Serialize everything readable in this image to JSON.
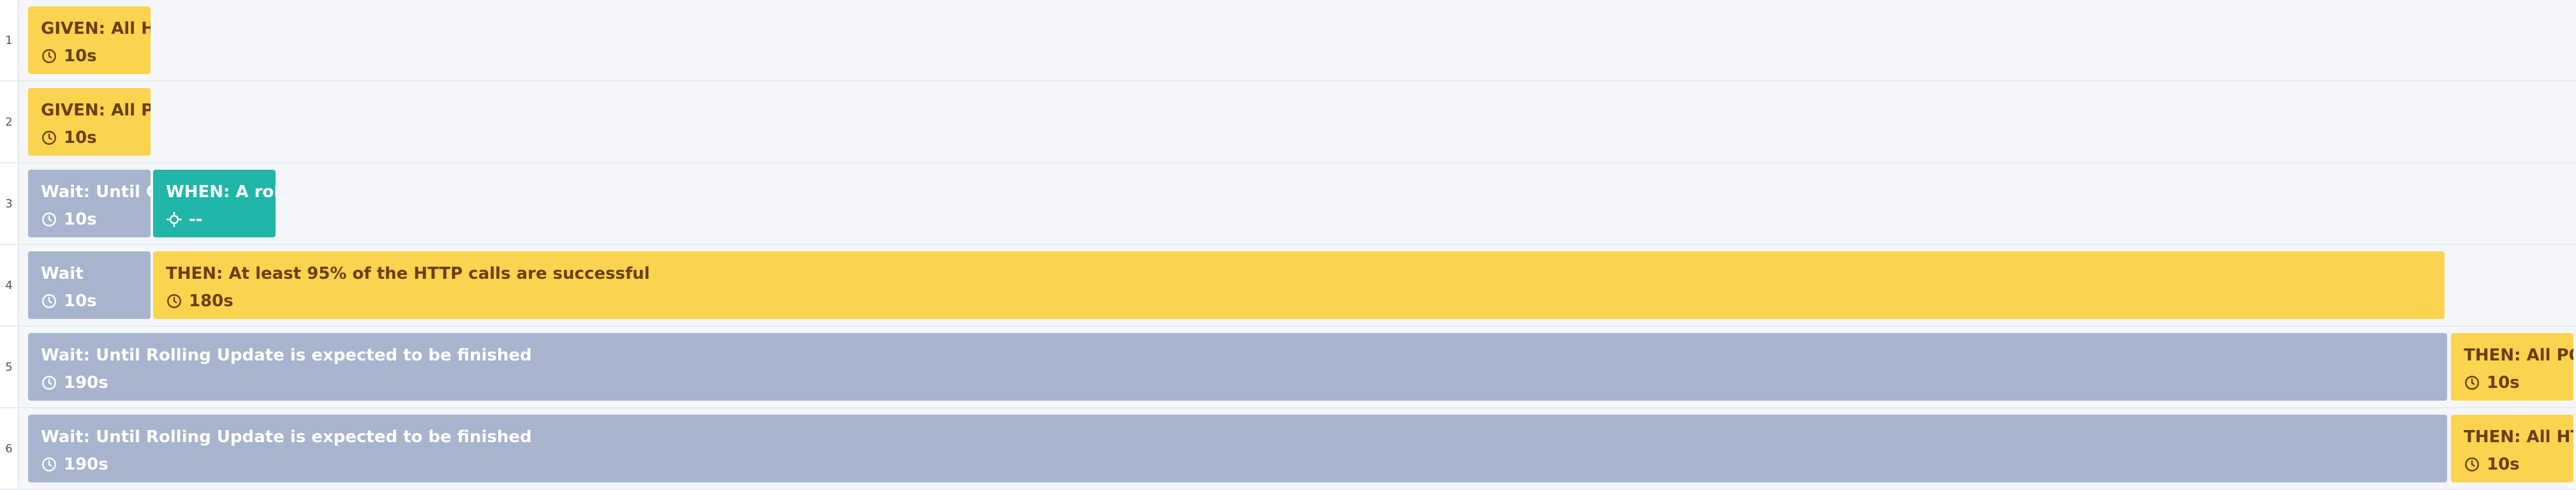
{
  "rows": [
    {
      "number": "1",
      "blocks": [
        {
          "kind": "given",
          "title": "GIVEN: All HTTP calls are successful",
          "meta_icon": "clock-icon",
          "meta": "10s"
        }
      ]
    },
    {
      "number": "2",
      "blocks": [
        {
          "kind": "given",
          "title": "GIVEN: All PODs are ready",
          "meta_icon": "clock-icon",
          "meta": "10s"
        }
      ]
    },
    {
      "number": "3",
      "blocks": [
        {
          "kind": "wait",
          "title": "Wait: Until GIVEN is fulfilled",
          "meta_icon": "clock-icon",
          "meta": "10s"
        },
        {
          "kind": "when",
          "title": "WHEN: A rolling update is triggered",
          "meta_icon": "crosshair-icon",
          "meta": "--"
        }
      ]
    },
    {
      "number": "4",
      "blocks": [
        {
          "kind": "wait",
          "title": "Wait",
          "meta_icon": "clock-icon",
          "meta": "10s"
        },
        {
          "kind": "then",
          "title": "THEN: At least 95% of the HTTP calls are successful",
          "meta_icon": "clock-icon",
          "meta": "180s"
        }
      ]
    },
    {
      "number": "5",
      "blocks": [
        {
          "kind": "wait",
          "title": "Wait: Until Rolling Update is expected to be finished",
          "meta_icon": "clock-icon",
          "meta": "190s"
        },
        {
          "kind": "then",
          "title": "THEN: All PODs are ready",
          "meta_icon": "clock-icon",
          "meta": "10s"
        }
      ]
    },
    {
      "number": "6",
      "blocks": [
        {
          "kind": "wait",
          "title": "Wait: Until Rolling Update is expected to be finished",
          "meta_icon": "clock-icon",
          "meta": "190s"
        },
        {
          "kind": "then",
          "title": "THEN: All HTTP calls are successful",
          "meta_icon": "clock-icon",
          "meta": "10s"
        }
      ]
    }
  ],
  "colors": {
    "given_then": "#fad44e",
    "wait": "#a6b5cd",
    "when": "#21b6aa",
    "dark_text": "#6b3f12",
    "background": "#f4f6fa"
  }
}
